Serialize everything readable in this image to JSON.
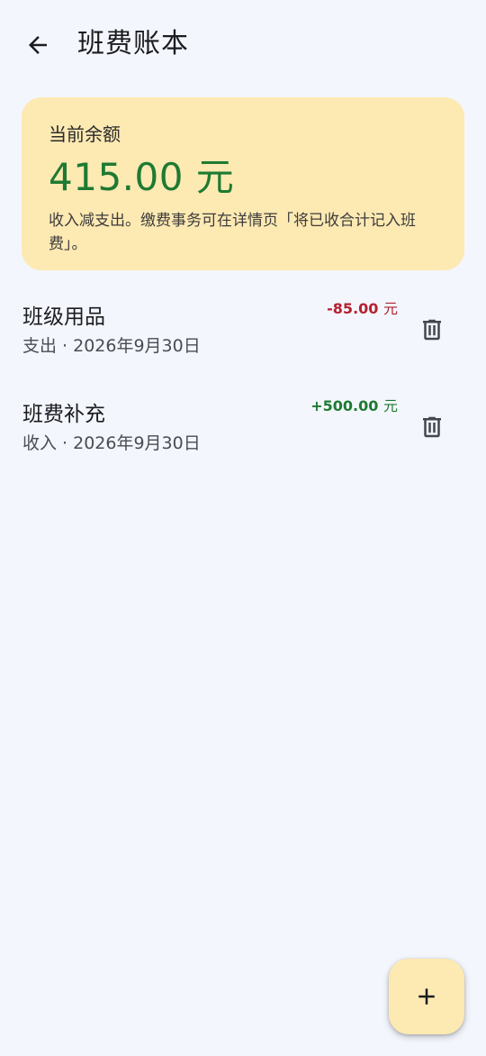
{
  "header": {
    "title": "班费账本",
    "back_icon": "arrow-back-icon"
  },
  "balance": {
    "label": "当前余额",
    "amount": "415.00 元",
    "note": "收入减支出。缴费事务可在详情页「将已收合计记入班费」。"
  },
  "transactions": [
    {
      "title": "班级用品",
      "subtitle": "支出 · 2026年9月30日",
      "amount": "-85.00",
      "unit": "元",
      "kind": "expense",
      "action_icon": "trash-icon"
    },
    {
      "title": "班费补充",
      "subtitle": "收入 · 2026年9月30日",
      "amount": "+500.00",
      "unit": "元",
      "kind": "income",
      "action_icon": "trash-icon"
    }
  ],
  "fab": {
    "icon": "plus-icon"
  },
  "colors": {
    "background": "#f4f6fd",
    "card": "#fde9b2",
    "income": "#1e7a32",
    "expense": "#b3222f"
  }
}
